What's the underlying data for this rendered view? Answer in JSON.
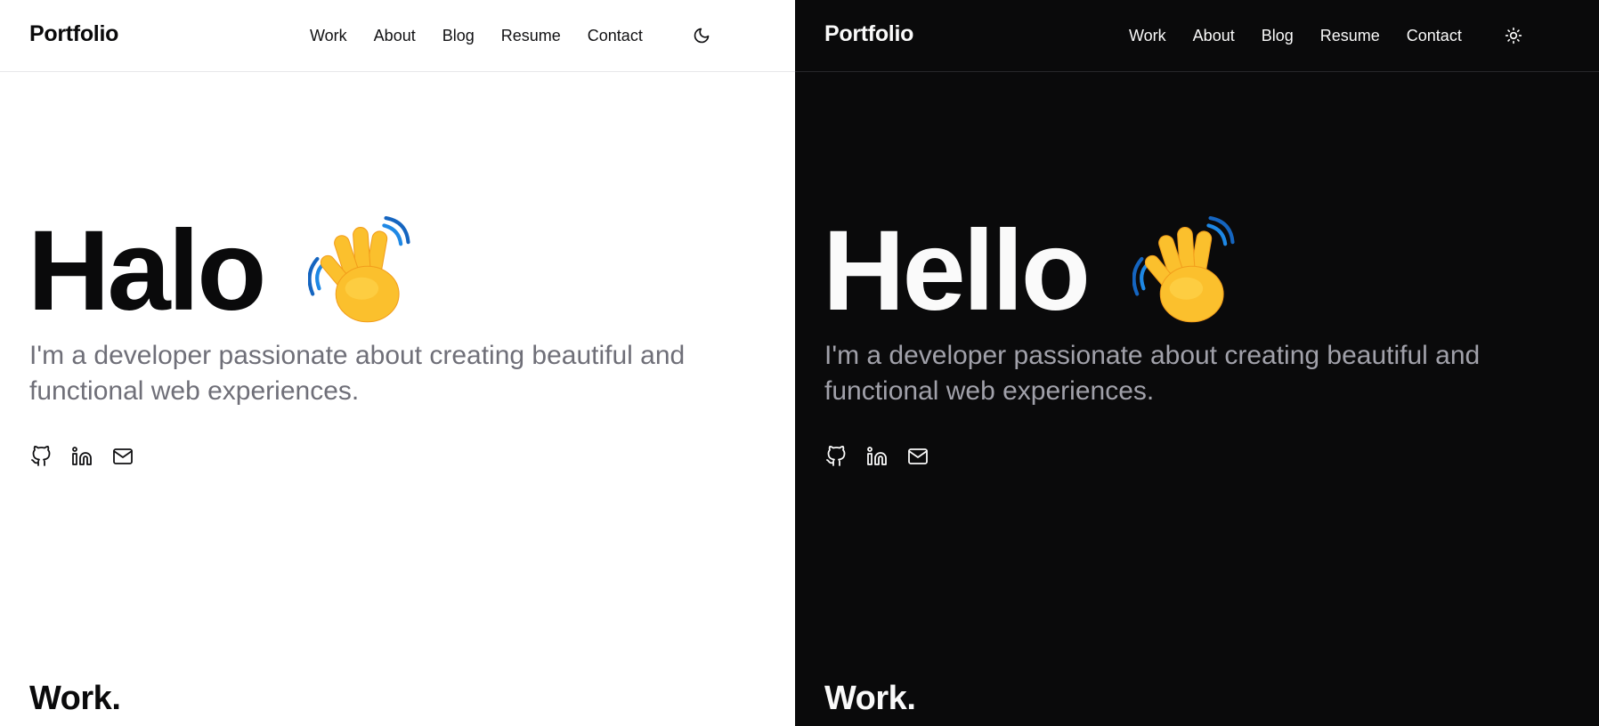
{
  "light": {
    "brand": "Portfolio",
    "nav": [
      "Work",
      "About",
      "Blog",
      "Resume",
      "Contact"
    ],
    "theme_icon": "moon-icon",
    "hero": {
      "title": "Halo",
      "emoji": "waving-hand",
      "subtitle": "I'm a developer passionate about creating beautiful and functional web experiences."
    },
    "socials": [
      "github-icon",
      "linkedin-icon",
      "mail-icon"
    ],
    "section_title": "Work."
  },
  "dark": {
    "brand": "Portfolio",
    "nav": [
      "Work",
      "About",
      "Blog",
      "Resume",
      "Contact"
    ],
    "theme_icon": "sun-icon",
    "hero": {
      "title": "Hello",
      "emoji": "waving-hand",
      "subtitle": "I'm a developer passionate about creating beautiful and functional web experiences."
    },
    "socials": [
      "github-icon",
      "linkedin-icon",
      "mail-icon"
    ],
    "section_title": "Work."
  },
  "colors": {
    "light_bg": "#ffffff",
    "dark_bg": "#0a0a0b",
    "muted_light": "#6f6f78",
    "muted_dark": "#a1a1aa",
    "wave_blue": "#1e88e5",
    "hand_yellow": "#f9b42c"
  }
}
